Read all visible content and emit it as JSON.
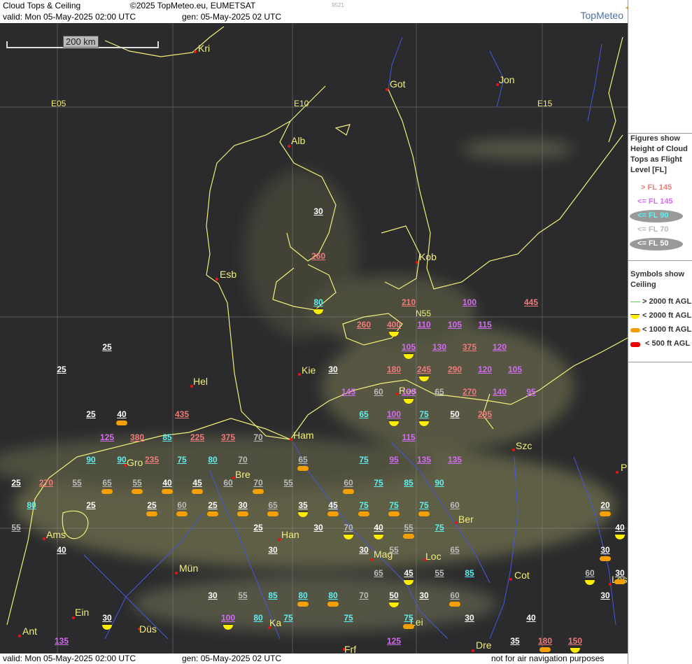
{
  "header": {
    "title": "Cloud Tops & Ceiling",
    "copyright": "©2025 TopMeteo.eu, EUMETSAT",
    "code": "9521",
    "valid": "valid:  Mon  05-May-2025  02:00 UTC",
    "gen": "gen: 05-May-2025 02 UTC",
    "brand": "TopMeteo"
  },
  "footer": {
    "valid": "valid:  Mon  05-May-2025  02:00 UTC",
    "gen": "gen: 05-May-2025 02 UTC",
    "disclaimer": "not for air navigation purposes"
  },
  "scale": {
    "label": "200 km"
  },
  "grid_labels": [
    "E05",
    "E10",
    "E15",
    "N55"
  ],
  "legend": {
    "figures_title": "Figures show Height of Cloud Tops as Flight Level  [FL]",
    "figures": [
      {
        "text": "> FL 145",
        "color": "#f07b7b"
      },
      {
        "text": "<= FL 145",
        "color": "#d36cf2"
      },
      {
        "text": "<= FL 90",
        "color": "#5ff0f0"
      },
      {
        "text": "<= FL 70",
        "color": "#bbbbbb"
      },
      {
        "text": "<= FL 50",
        "color": "#ffffff"
      }
    ],
    "symbols_title": "Symbols show Ceiling",
    "symbols": [
      {
        "text": "> 2000 ft AGL",
        "type": "line"
      },
      {
        "text": "< 2000 ft AGL",
        "type": "yellow"
      },
      {
        "text": "< 1000 ft AGL",
        "type": "orange"
      },
      {
        "text": "< 500 ft AGL",
        "type": "red"
      }
    ]
  },
  "colors": {
    "red_level": "#f07b7b",
    "violet_level": "#d36cf2",
    "cyan_level": "#5ff0f0",
    "grey_level": "#bbbbbb",
    "white_level": "#ffffff",
    "coast": "#f2ef7a",
    "river": "#4657e0"
  },
  "cities": [
    "Kri",
    "Got",
    "Jon",
    "Alb",
    "Esb",
    "Kob",
    "Kie",
    "Hel",
    "Ros",
    "Ham",
    "Gro",
    "Bre",
    "Szc",
    "Ber",
    "Ams",
    "Han",
    "Mag",
    "Loc",
    "Mün",
    "Cot",
    "Les",
    "Ein",
    "Ka",
    "Lei",
    "Ant",
    "Düs",
    "Frf",
    "Dre",
    "P"
  ],
  "figures": [
    {
      "v": "30",
      "c": "white",
      "s": ""
    },
    {
      "v": "260",
      "c": "red",
      "s": ""
    },
    {
      "v": "80",
      "c": "cyan",
      "s": "yellow"
    },
    {
      "v": "210",
      "c": "red",
      "s": ""
    },
    {
      "v": "100",
      "c": "violet",
      "s": ""
    },
    {
      "v": "445",
      "c": "red",
      "s": ""
    },
    {
      "v": "260",
      "c": "red",
      "s": ""
    },
    {
      "v": "400",
      "c": "red",
      "s": "yellow"
    },
    {
      "v": "110",
      "c": "violet",
      "s": ""
    },
    {
      "v": "105",
      "c": "violet",
      "s": ""
    },
    {
      "v": "115",
      "c": "violet",
      "s": ""
    },
    {
      "v": "105",
      "c": "violet",
      "s": "yellow"
    },
    {
      "v": "130",
      "c": "violet",
      "s": ""
    },
    {
      "v": "375",
      "c": "red",
      "s": ""
    },
    {
      "v": "120",
      "c": "violet",
      "s": ""
    },
    {
      "v": "25",
      "c": "white",
      "s": ""
    },
    {
      "v": "25",
      "c": "white",
      "s": ""
    },
    {
      "v": "30",
      "c": "white",
      "s": ""
    },
    {
      "v": "180",
      "c": "red",
      "s": ""
    },
    {
      "v": "245",
      "c": "red",
      "s": "yellow"
    },
    {
      "v": "290",
      "c": "red",
      "s": ""
    },
    {
      "v": "120",
      "c": "violet",
      "s": ""
    },
    {
      "v": "105",
      "c": "violet",
      "s": ""
    },
    {
      "v": "145",
      "c": "violet",
      "s": ""
    },
    {
      "v": "60",
      "c": "grey",
      "s": ""
    },
    {
      "v": "130",
      "c": "violet",
      "s": "yellow"
    },
    {
      "v": "65",
      "c": "grey",
      "s": ""
    },
    {
      "v": "270",
      "c": "red",
      "s": ""
    },
    {
      "v": "140",
      "c": "violet",
      "s": ""
    },
    {
      "v": "95",
      "c": "violet",
      "s": ""
    },
    {
      "v": "25",
      "c": "white",
      "s": ""
    },
    {
      "v": "40",
      "c": "white",
      "s": "orange"
    },
    {
      "v": "435",
      "c": "red",
      "s": ""
    },
    {
      "v": "65",
      "c": "cyan",
      "s": ""
    },
    {
      "v": "100",
      "c": "violet",
      "s": "yellow"
    },
    {
      "v": "75",
      "c": "cyan",
      "s": "yellow"
    },
    {
      "v": "50",
      "c": "white",
      "s": ""
    },
    {
      "v": "295",
      "c": "red",
      "s": ""
    },
    {
      "v": "125",
      "c": "violet",
      "s": ""
    },
    {
      "v": "380",
      "c": "red",
      "s": ""
    },
    {
      "v": "85",
      "c": "cyan",
      "s": ""
    },
    {
      "v": "225",
      "c": "red",
      "s": ""
    },
    {
      "v": "375",
      "c": "red",
      "s": ""
    },
    {
      "v": "70",
      "c": "grey",
      "s": ""
    },
    {
      "v": "115",
      "c": "violet",
      "s": ""
    },
    {
      "v": "90",
      "c": "cyan",
      "s": ""
    },
    {
      "v": "90",
      "c": "cyan",
      "s": ""
    },
    {
      "v": "235",
      "c": "red",
      "s": ""
    },
    {
      "v": "75",
      "c": "cyan",
      "s": ""
    },
    {
      "v": "80",
      "c": "cyan",
      "s": ""
    },
    {
      "v": "70",
      "c": "grey",
      "s": ""
    },
    {
      "v": "65",
      "c": "grey",
      "s": "orange"
    },
    {
      "v": "75",
      "c": "cyan",
      "s": ""
    },
    {
      "v": "95",
      "c": "violet",
      "s": ""
    },
    {
      "v": "135",
      "c": "violet",
      "s": ""
    },
    {
      "v": "135",
      "c": "violet",
      "s": ""
    },
    {
      "v": "25",
      "c": "white",
      "s": ""
    },
    {
      "v": "270",
      "c": "red",
      "s": ""
    },
    {
      "v": "55",
      "c": "grey",
      "s": ""
    },
    {
      "v": "65",
      "c": "grey",
      "s": "orange"
    },
    {
      "v": "55",
      "c": "grey",
      "s": "orange"
    },
    {
      "v": "40",
      "c": "white",
      "s": "orange"
    },
    {
      "v": "45",
      "c": "white",
      "s": "orange"
    },
    {
      "v": "60",
      "c": "grey",
      "s": ""
    },
    {
      "v": "70",
      "c": "grey",
      "s": "orange"
    },
    {
      "v": "55",
      "c": "grey",
      "s": ""
    },
    {
      "v": "60",
      "c": "grey",
      "s": "orange"
    },
    {
      "v": "75",
      "c": "cyan",
      "s": ""
    },
    {
      "v": "85",
      "c": "cyan",
      "s": ""
    },
    {
      "v": "90",
      "c": "cyan",
      "s": ""
    },
    {
      "v": "80",
      "c": "cyan",
      "s": ""
    },
    {
      "v": "25",
      "c": "white",
      "s": ""
    },
    {
      "v": "25",
      "c": "white",
      "s": "orange"
    },
    {
      "v": "60",
      "c": "grey",
      "s": "orange"
    },
    {
      "v": "25",
      "c": "white",
      "s": "orange"
    },
    {
      "v": "30",
      "c": "white",
      "s": "orange"
    },
    {
      "v": "65",
      "c": "grey",
      "s": "orange"
    },
    {
      "v": "35",
      "c": "white",
      "s": "yellow"
    },
    {
      "v": "45",
      "c": "white",
      "s": "orange"
    },
    {
      "v": "75",
      "c": "cyan",
      "s": "orange"
    },
    {
      "v": "75",
      "c": "cyan",
      "s": "orange"
    },
    {
      "v": "75",
      "c": "cyan",
      "s": "orange"
    },
    {
      "v": "60",
      "c": "grey",
      "s": ""
    },
    {
      "v": "20",
      "c": "white",
      "s": "orange"
    },
    {
      "v": "55",
      "c": "grey",
      "s": ""
    },
    {
      "v": "25",
      "c": "white",
      "s": ""
    },
    {
      "v": "30",
      "c": "white",
      "s": ""
    },
    {
      "v": "70",
      "c": "grey",
      "s": "yellow"
    },
    {
      "v": "40",
      "c": "white",
      "s": "yellow"
    },
    {
      "v": "55",
      "c": "grey",
      "s": "orange"
    },
    {
      "v": "75",
      "c": "cyan",
      "s": ""
    },
    {
      "v": "40",
      "c": "white",
      "s": "yellow"
    },
    {
      "v": "40",
      "c": "white",
      "s": ""
    },
    {
      "v": "30",
      "c": "white",
      "s": ""
    },
    {
      "v": "30",
      "c": "white",
      "s": ""
    },
    {
      "v": "55",
      "c": "grey",
      "s": ""
    },
    {
      "v": "65",
      "c": "grey",
      "s": ""
    },
    {
      "v": "30",
      "c": "white",
      "s": "orange"
    },
    {
      "v": "65",
      "c": "grey",
      "s": ""
    },
    {
      "v": "45",
      "c": "white",
      "s": "yellow"
    },
    {
      "v": "55",
      "c": "grey",
      "s": ""
    },
    {
      "v": "85",
      "c": "cyan",
      "s": ""
    },
    {
      "v": "60",
      "c": "grey",
      "s": "yellow"
    },
    {
      "v": "30",
      "c": "white",
      "s": "orange"
    },
    {
      "v": "30",
      "c": "white",
      "s": ""
    },
    {
      "v": "55",
      "c": "grey",
      "s": ""
    },
    {
      "v": "85",
      "c": "cyan",
      "s": ""
    },
    {
      "v": "80",
      "c": "cyan",
      "s": "orange"
    },
    {
      "v": "80",
      "c": "cyan",
      "s": "orange"
    },
    {
      "v": "70",
      "c": "grey",
      "s": ""
    },
    {
      "v": "50",
      "c": "white",
      "s": "yellow"
    },
    {
      "v": "30",
      "c": "white",
      "s": ""
    },
    {
      "v": "60",
      "c": "grey",
      "s": "orange"
    },
    {
      "v": "30",
      "c": "white",
      "s": ""
    },
    {
      "v": "30",
      "c": "white",
      "s": "yellow"
    },
    {
      "v": "100",
      "c": "violet",
      "s": "yellow"
    },
    {
      "v": "80",
      "c": "cyan",
      "s": ""
    },
    {
      "v": "75",
      "c": "cyan",
      "s": ""
    },
    {
      "v": "75",
      "c": "cyan",
      "s": ""
    },
    {
      "v": "75",
      "c": "cyan",
      "s": "orange"
    },
    {
      "v": "30",
      "c": "white",
      "s": ""
    },
    {
      "v": "40",
      "c": "white",
      "s": ""
    },
    {
      "v": "135",
      "c": "violet",
      "s": ""
    },
    {
      "v": "125",
      "c": "violet",
      "s": ""
    },
    {
      "v": "35",
      "c": "white",
      "s": ""
    },
    {
      "v": "180",
      "c": "red",
      "s": "orange"
    },
    {
      "v": "150",
      "c": "red",
      "s": "yellow"
    },
    {
      "v": "45",
      "c": "white",
      "s": ""
    }
  ]
}
